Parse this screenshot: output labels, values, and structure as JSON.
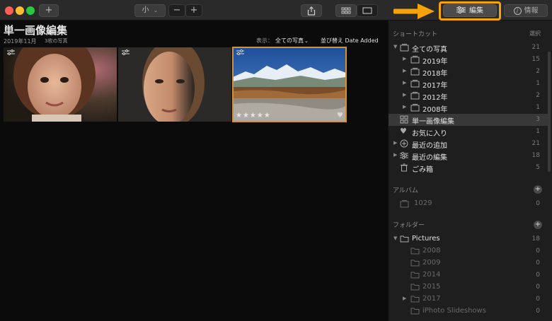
{
  "toolbar": {
    "add_label": "+",
    "size_label": "小",
    "zoom_out_label": "−",
    "zoom_in_label": "+",
    "edit_tab_label": "編集",
    "info_tab_label": "情報"
  },
  "header": {
    "title": "単一画像編集",
    "date": "2019年11月",
    "count": "3枚の写真",
    "view_label": "表示：",
    "view_value": "全ての写真",
    "sort_label": "並び替え Date Added"
  },
  "photos": [
    {
      "rating": "",
      "favorite": false
    },
    {
      "rating": "",
      "favorite": false
    },
    {
      "rating": "★★★★★",
      "favorite": true
    }
  ],
  "sidebar": {
    "shortcuts_header": "ショートカット",
    "select_label": "選択",
    "shortcuts": [
      {
        "label": "全ての写真",
        "count": "21"
      },
      {
        "label": "2019年",
        "count": "15"
      },
      {
        "label": "2018年",
        "count": "2"
      },
      {
        "label": "2017年",
        "count": "1"
      },
      {
        "label": "2012年",
        "count": "2"
      },
      {
        "label": "2008年",
        "count": "1"
      },
      {
        "label": "単一画像編集",
        "count": "3"
      },
      {
        "label": "お気に入り",
        "count": "1"
      },
      {
        "label": "最近の追加",
        "count": "21"
      },
      {
        "label": "最近の編集",
        "count": "18"
      },
      {
        "label": "ごみ箱",
        "count": "5"
      }
    ],
    "albums_header": "アルバム",
    "albums": [
      {
        "label": "1029",
        "count": "0"
      }
    ],
    "folders_header": "フォルダー",
    "folders": [
      {
        "label": "Pictures",
        "count": "18"
      },
      {
        "label": "2008",
        "count": "0"
      },
      {
        "label": "2009",
        "count": "0"
      },
      {
        "label": "2014",
        "count": "0"
      },
      {
        "label": "2015",
        "count": "0"
      },
      {
        "label": "2017",
        "count": "0"
      },
      {
        "label": "iPhoto Slideshows",
        "count": "0"
      }
    ]
  },
  "colors": {
    "accent_highlight": "#f5a30a",
    "selection_border": "#d39530"
  }
}
